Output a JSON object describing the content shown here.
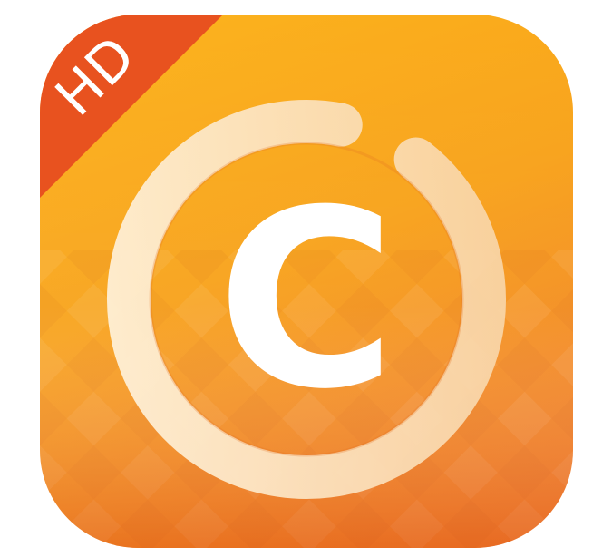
{
  "app_icon": {
    "badge_text": "HD",
    "glyph_text": "C",
    "icon_name": "circular-c-logo-icon",
    "colors": {
      "badge": "#e8521f",
      "background_top": "#fcb51e",
      "background_bottom": "#ef7426",
      "ring": "#fbe3c0",
      "glyph": "#ffffff"
    }
  }
}
